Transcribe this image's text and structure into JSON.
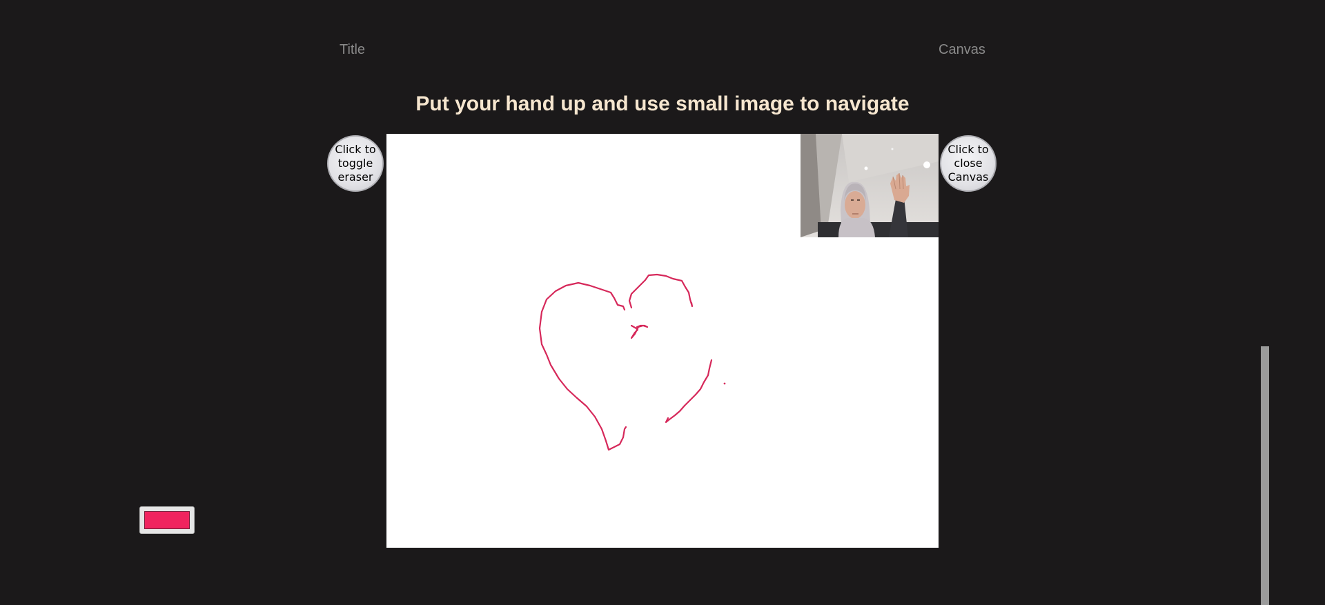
{
  "nav": {
    "title_link": "Title",
    "canvas_link": "Canvas"
  },
  "instruction": "Put your hand up and use small image to navigate",
  "buttons": {
    "eraser_label": "Click to toggle eraser",
    "close_label": "Click to close Canvas"
  },
  "brush_color": "#f0245f",
  "stroke_color": "#d6285a",
  "webcam": {
    "content": "webcam preview of a person raising their hand"
  }
}
